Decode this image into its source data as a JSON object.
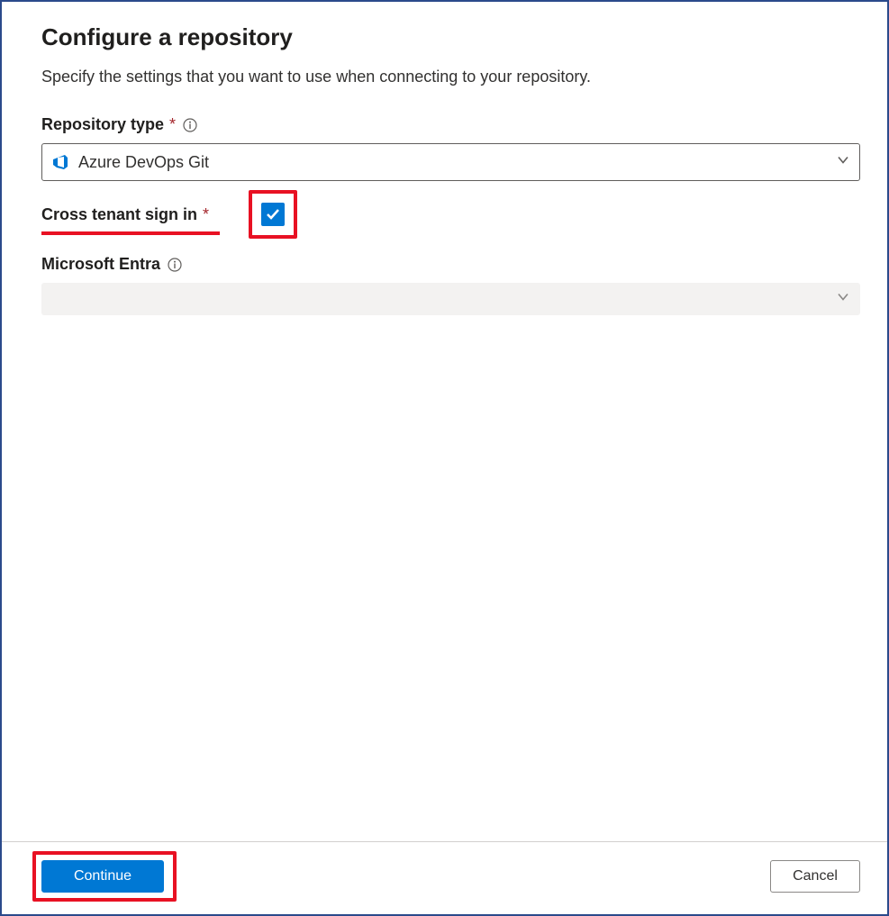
{
  "header": {
    "title": "Configure a repository",
    "subtitle": "Specify the settings that you want to use when connecting to your repository."
  },
  "fields": {
    "repository_type": {
      "label": "Repository type",
      "required_marker": "*",
      "selected_value": "Azure DevOps Git",
      "icon": "azure-devops-icon"
    },
    "cross_tenant": {
      "label": "Cross tenant sign in",
      "required_marker": "*",
      "checked": true
    },
    "microsoft_entra": {
      "label": "Microsoft Entra",
      "selected_value": ""
    }
  },
  "footer": {
    "continue_label": "Continue",
    "cancel_label": "Cancel"
  },
  "colors": {
    "primary": "#0078d4",
    "highlight": "#e81123",
    "border": "#2b4a8b"
  }
}
